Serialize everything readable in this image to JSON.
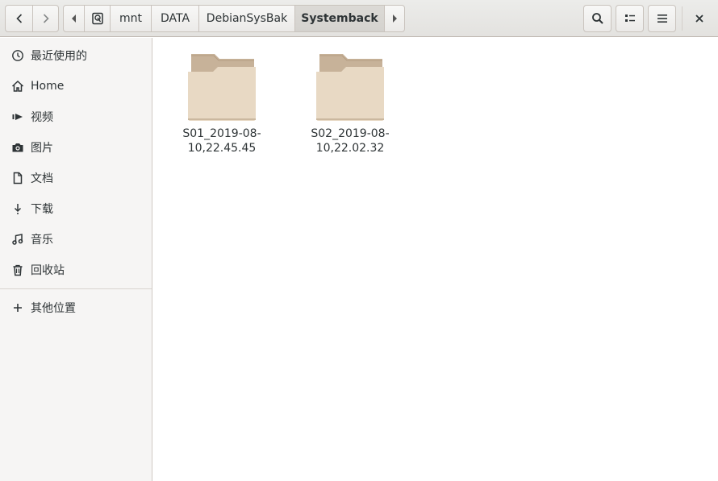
{
  "pathbar": {
    "segments": [
      "mnt",
      "DATA",
      "DebianSysBak"
    ],
    "current": "Systemback"
  },
  "sidebar": {
    "items": [
      {
        "label": "最近使用的",
        "icon": "recent-icon"
      },
      {
        "label": "Home",
        "icon": "home-icon"
      },
      {
        "label": "视频",
        "icon": "video-icon"
      },
      {
        "label": "图片",
        "icon": "camera-icon"
      },
      {
        "label": "文档",
        "icon": "document-icon"
      },
      {
        "label": "下载",
        "icon": "download-icon"
      },
      {
        "label": "音乐",
        "icon": "music-icon"
      },
      {
        "label": "回收站",
        "icon": "trash-icon"
      }
    ],
    "other": {
      "label": "其他位置",
      "icon": "plus-icon"
    }
  },
  "files": [
    {
      "line1": "S01_2019-08-",
      "line2": "10,22.45.45",
      "icon": "folder-icon"
    },
    {
      "line1": "S02_2019-08-",
      "line2": "10,22.02.32",
      "icon": "folder-icon"
    }
  ],
  "colors": {
    "folder_back": "#c7b299",
    "folder_front": "#e8d9c4",
    "sidebar_bg": "#f6f5f4",
    "header_bg": "#e8e7e4"
  }
}
